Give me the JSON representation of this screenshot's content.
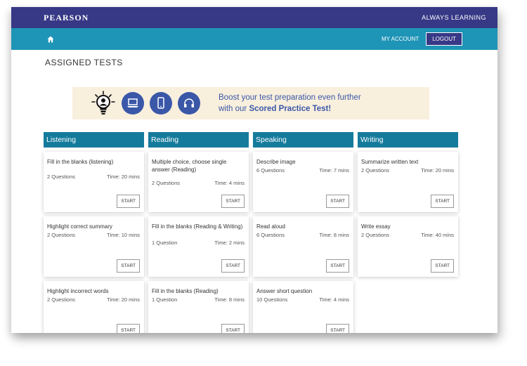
{
  "header": {
    "brand": "PEARSON",
    "tagline": "ALWAYS LEARNING"
  },
  "nav": {
    "my_account": "MY ACCOUNT",
    "logout": "LOGOUT"
  },
  "page": {
    "title": "ASSIGNED TESTS"
  },
  "banner": {
    "line1": "Boost your test preparation even further",
    "line2_prefix": "with our ",
    "line2_highlight": "Scored Practice Test!"
  },
  "columns": [
    {
      "title": "Listening",
      "cards": [
        {
          "title": "Fill in the blanks (listening)",
          "questions": "2 Questions",
          "time": "Time: 20 mins",
          "start": "START"
        },
        {
          "title": "Highlight correct summary",
          "questions": "2 Questions",
          "time": "Time: 10 mins",
          "start": "START"
        },
        {
          "title": "Highlight incorrect words",
          "questions": "2 Questions",
          "time": "Time: 20 mins",
          "start": "START"
        }
      ]
    },
    {
      "title": "Reading",
      "cards": [
        {
          "title": "Multiple choice, choose single answer (Reading)",
          "questions": "2 Questions",
          "time": "Time: 4 mins",
          "start": "START"
        },
        {
          "title": "Fill in the blanks (Reading & Writing)",
          "questions": "1 Question",
          "time": "Time: 2 mins",
          "start": "START"
        },
        {
          "title": "Fill in the blanks (Reading)",
          "questions": "1 Question",
          "time": "Time: 8 mins",
          "start": "START"
        }
      ]
    },
    {
      "title": "Speaking",
      "cards": [
        {
          "title": "Describe image",
          "questions": "6 Questions",
          "time": "Time: 7 mins",
          "start": "START"
        },
        {
          "title": "Read aloud",
          "questions": "6 Questions",
          "time": "Time: 8 mins",
          "start": "START"
        },
        {
          "title": "Answer short question",
          "questions": "10 Questions",
          "time": "Time: 4 mins",
          "start": "START"
        }
      ]
    },
    {
      "title": "Writing",
      "cards": [
        {
          "title": "Summarize written text",
          "questions": "2 Questions",
          "time": "Time: 20 mins",
          "start": "START"
        },
        {
          "title": "Write essay",
          "questions": "2 Questions",
          "time": "Time: 40 mins",
          "start": "START"
        }
      ]
    }
  ],
  "colors": {
    "brand_purple": "#373886",
    "nav_teal": "#1e94b6",
    "header_teal": "#157b9c",
    "banner_bg": "#f8efdd",
    "banner_blue": "#3a57a8"
  },
  "icons": [
    "home-icon",
    "lightbulb-person-icon",
    "laptop-chat-icon",
    "mobile-chat-icon",
    "headphones-chat-icon"
  ]
}
